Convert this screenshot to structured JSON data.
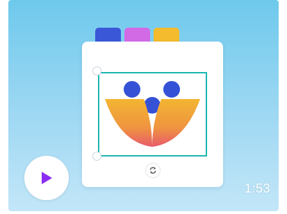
{
  "video": {
    "duration": "1:53"
  },
  "palette": {
    "swatches": [
      "#3a57d8",
      "#d26ae6",
      "#f3bb2d"
    ]
  },
  "icons": {
    "play": "play-icon",
    "rotate": "rotate-icon"
  },
  "colors": {
    "dots": "#3551d6",
    "petal_top": "#f2b531",
    "petal_bottom": "#e85a6c",
    "selection": "#19b6b0",
    "play_glyph": "#8b2df0"
  }
}
